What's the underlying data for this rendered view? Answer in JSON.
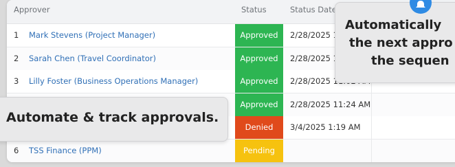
{
  "table": {
    "headers": {
      "approver": "Approver",
      "status": "Status",
      "status_date": "Status Date"
    },
    "rows": [
      {
        "num": "1",
        "approver": "Mark Stevens (Project Manager)",
        "status": "Approved",
        "date": "2/28/2025 1"
      },
      {
        "num": "2",
        "approver": "Sarah Chen (Travel Coordinator)",
        "status": "Approved",
        "date": "2/28/2025 1"
      },
      {
        "num": "3",
        "approver": "Lilly Foster (Business Operations Manager)",
        "status": "Approved",
        "date": "2/28/2025 11:02 AM"
      },
      {
        "num": "",
        "approver": "",
        "status": "Approved",
        "date": "2/28/2025 11:24 AM"
      },
      {
        "num": "",
        "approver": "",
        "status": "Denied",
        "date": "3/4/2025 1:19 AM"
      },
      {
        "num": "6",
        "approver": "TSS Finance (PPM)",
        "status": "Pending",
        "date": ""
      }
    ]
  },
  "status_colors": {
    "Approved": "#2db552",
    "Denied": "#e04a1b",
    "Pending": "#f6c20f"
  },
  "callouts": {
    "left": "Automate & track approvals.",
    "right_line1": "Automatically",
    "right_line2": "the next appro",
    "right_line3": "the sequen"
  },
  "icons": {
    "notification": "bell-icon"
  }
}
